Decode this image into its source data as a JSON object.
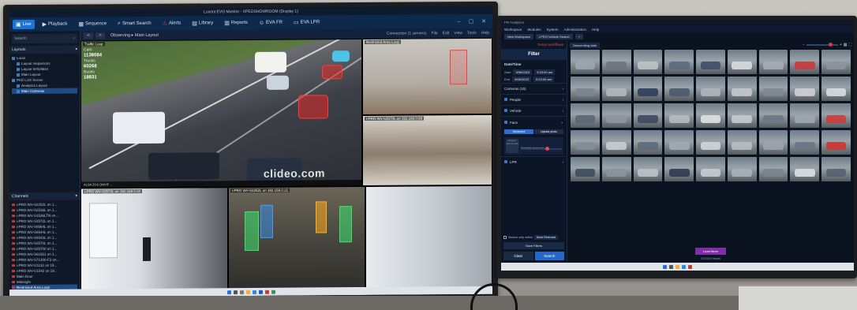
{
  "left_app": {
    "window_title": "Luxriot EVO Monitor - XPEOSHOWROOM (Display 1)",
    "menu": [
      {
        "label": "Live",
        "icon": "live-icon",
        "active": true
      },
      {
        "label": "Playback",
        "icon": "playback-icon"
      },
      {
        "label": "Sequence",
        "icon": "sequence-icon"
      },
      {
        "label": "Smart Search",
        "icon": "smart-search-icon"
      },
      {
        "label": "Alerts",
        "icon": "alerts-icon"
      },
      {
        "label": "Library",
        "icon": "library-icon"
      },
      {
        "label": "Reports",
        "icon": "reports-icon"
      },
      {
        "label": "EVA FR",
        "icon": "eva-fr-icon"
      },
      {
        "label": "EVA LPR",
        "icon": "eva-lpr-icon"
      }
    ],
    "search_placeholder": "Search",
    "layouts_header": "Layouts",
    "layout_tree": [
      {
        "label": "Local",
        "selected": false
      },
      {
        "label": "Layout sequences",
        "selected": false
      },
      {
        "label": "Layout templates",
        "selected": false
      },
      {
        "label": "Main Layout",
        "selected": false
      },
      {
        "label": "PHZ LUX Server",
        "selected": false
      },
      {
        "label": "Analytics Layout",
        "selected": false
      },
      {
        "label": "Main Cameras",
        "selected": true
      }
    ],
    "channels_header": "Channels",
    "channels": [
      "i-PRO WV-S2252L on 1...",
      "i-PRO WV-S2536L on 1...",
      "i-PRO WV-S1536LTN on...",
      "i-PRO WV-S2572L on 1...",
      "i-PRO WV-S8564L on 1...",
      "i-PRO WV-S8544L on 1...",
      "i-PRO WV-S8543L on 1...",
      "i-PRO WV-S2570L on 1...",
      "i-PRO WV-S25700 on 1...",
      "i-PRO WV-S61501 on 1...",
      "i-PRO WV-S71300-F3 on...",
      "i-PRO WV-U1132 on 19...",
      "i-PRO WV-U1542 on 19...",
      "Main Door",
      "Milesight",
      "Restricted Area Loop",
      "Traffic Loop"
    ],
    "nav_back": "<",
    "nav_forward": ">",
    "breadcrumb": "Observing ▸ Main Layout",
    "connection": "Connection (1 servers)",
    "right_menu": [
      "File",
      "Edit",
      "View",
      "Tools",
      "Help"
    ],
    "tiles": {
      "traffic": {
        "label": "Traffic Loop",
        "stats_cars_label": "Cars",
        "stats_cars": "1138084",
        "stats_trucks_label": "Trucks",
        "stats_trucks": "60268",
        "stats_buses_label": "Buses",
        "stats_buses": "18831",
        "watermark": "clideo.com",
        "bottom": "ALSA  29.6  ONVIF  ..."
      },
      "restricted": {
        "label": "Restricted Area Loop"
      },
      "cafe": {
        "label": "i-PRO WV-S2570L on 192.168.0.58"
      },
      "lobby": {
        "label": "i-PRO WV-S2572L on 192.168.0.20"
      },
      "office": {
        "label": "i-PRO WV-S2252L on 192.168.0.21"
      },
      "corridor": {
        "label": ""
      }
    }
  },
  "right_app": {
    "title": "FR Analytics",
    "menu": [
      "Workspace",
      "Modules",
      "System",
      "Administration",
      "Help"
    ],
    "tabs": [
      "New Workspace",
      "i-PRO Vehicle Search",
      "+"
    ],
    "setup": "Setup workflows",
    "filter_title": "Filter",
    "datetime_label": "Date/Time",
    "start_label": "Start",
    "start_date": "9/06/2023",
    "start_time": "9:23:00 am",
    "end_label": "End",
    "end_date": "9/06/2023",
    "end_time": "9:23:00 am",
    "cameras": "Cameras (15)",
    "people": "People",
    "vehicle": "Vehicle",
    "face": "Face",
    "face_tabs": [
      "Advanced",
      "Upload photo"
    ],
    "face_placeholder": "Drag or click to add",
    "similarity": "Similarity threshold",
    "lpr": "LPR",
    "search_only_label": "Search only within",
    "search_only_value": "Most Relevant",
    "save_search": "Save Filters",
    "clear_button": "Clear",
    "search_button": "Search",
    "sort": "Descending date",
    "load_more": "Load More",
    "results": "2/2/2020 results",
    "thumb_colors": [
      "#9aa6b0",
      "#6b7480",
      "#c0c4c6",
      "#5b6c7c",
      "#3e4f66",
      "#d9dde0",
      "#a5aeb5",
      "#c93a3a",
      "#8d949a",
      "#7b8590",
      "#b3b8bb",
      "#2f3e5c",
      "#4a5a6e",
      "#aeb6bd",
      "#c4c9cc",
      "#7e8891",
      "#ced2d6",
      "#d8dde1",
      "#5a6773",
      "#8e96a0",
      "#3b4a62",
      "#b6bcc1",
      "#dfe2e4",
      "#c5ccd0",
      "#6d7883",
      "#9ea7af",
      "#cf3b3b",
      "#848c95",
      "#c9ced1",
      "#5e6b77",
      "#a2abb2",
      "#d2d6d9",
      "#b8bfc4",
      "#9ca4ab",
      "#6a7682",
      "#cc3535",
      "#3f4d5f",
      "#8b939b",
      "#bcc2c6",
      "#2e3b52",
      "#c7cdd1",
      "#a9b1b8",
      "#7a848e",
      "#dbe0e3",
      "#556270"
    ]
  }
}
